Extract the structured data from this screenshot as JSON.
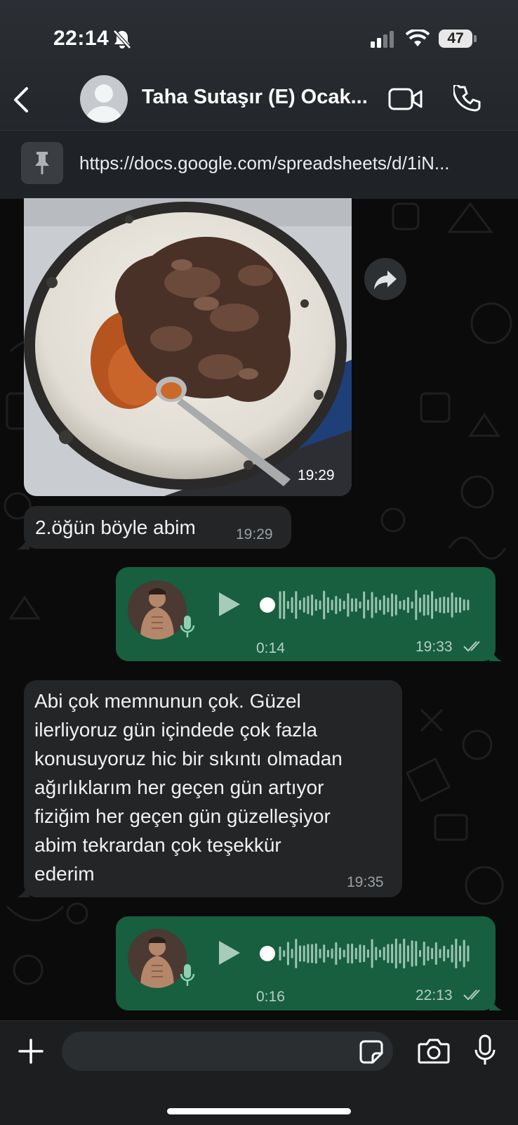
{
  "status_bar": {
    "time": "22:14",
    "battery": "47"
  },
  "header": {
    "title": "Taha Sutaşır (E) Ocak...",
    "pinned_url": "https://docs.google.com/spreadsheets/d/1iN..."
  },
  "messages": {
    "image_msg": {
      "time": "19:29"
    },
    "text1": {
      "text": "2.öğün böyle abim",
      "time": "19:29"
    },
    "voice1": {
      "duration": "0:14",
      "time": "19:33"
    },
    "text2": {
      "lines": [
        "Abi çok memnunun çok. Güzel",
        "ilerliyoruz gün içindede çok fazla",
        "konusuyoruz hic bir sıkıntı olmadan",
        "ağırlıklarım her geçen gün artıyor",
        "fiziğim her geçen gün güzelleşiyor",
        "abim tekrardan çok teşekkür",
        "ederim"
      ],
      "time": "19:35"
    },
    "voice2": {
      "duration": "0:16",
      "time": "22:13"
    }
  },
  "icons": {
    "back": "chevron-left-icon",
    "video": "video-call-icon",
    "phone": "phone-icon",
    "pin": "pin-icon",
    "forward": "forward-icon",
    "play": "play-icon",
    "mic": "mic-icon",
    "plus": "plus-icon",
    "sticker": "sticker-icon",
    "camera": "camera-icon"
  },
  "colors": {
    "outgoing_bubble": "#175f3f",
    "incoming_bubble": "#232527",
    "header": "#23272b",
    "read_ticks": "#b6cfc4"
  }
}
